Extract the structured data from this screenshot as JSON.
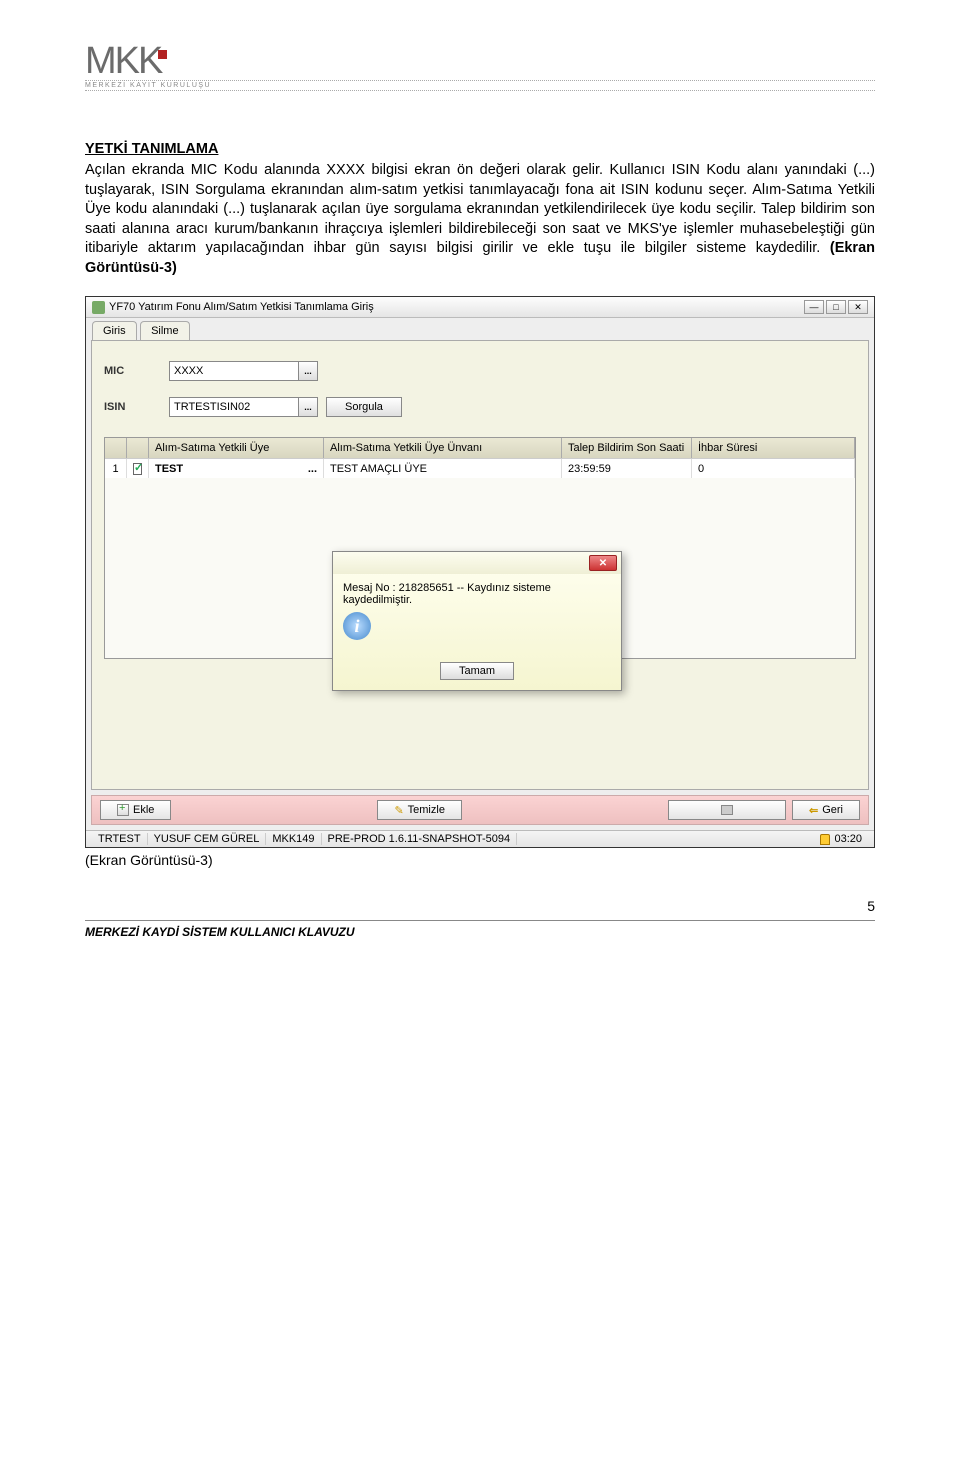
{
  "logo": {
    "text": "MKK",
    "subtitle": "MERKEZİ KAYIT KURULUŞU"
  },
  "section_title": "YETKİ TANIMLAMA",
  "body_text": "Açılan ekranda MIC Kodu alanında XXXX bilgisi ekran ön değeri olarak gelir. Kullanıcı ISIN Kodu alanı yanındaki (...) tuşlayarak, ISIN Sorgulama ekranından alım-satım yetkisi tanımlayacağı fona ait ISIN kodunu seçer. Alım-Satıma Yetkili Üye kodu alanındaki (...) tuşlanarak açılan üye sorgulama ekranından yetkilendirilecek üye kodu seçilir. Talep bildirim son saati alanına aracı kurum/bankanın ihraçcıya işlemleri bildirebileceği son saat ve  MKS'ye işlemler muhasebeleştiği gün itibariyle aktarım yapılacağından ihbar gün sayısı bilgisi girilir ve ekle tuşu ile bilgiler sisteme kaydedilir. ",
  "body_bold_suffix": "(Ekran Görüntüsü-3)",
  "window": {
    "title": "YF70 Yatırım Fonu Alım/Satım Yetkisi Tanımlama Giriş",
    "tabs": [
      "Giris",
      "Silme"
    ],
    "form": {
      "mic_label": "MIC",
      "mic_value": "XXXX",
      "isin_label": "ISIN",
      "isin_value": "TRTESTISIN02",
      "sorgula_label": "Sorgula"
    },
    "grid": {
      "headers": {
        "uye": "Alım-Satıma Yetkili Üye",
        "unvan": "Alım-Satıma Yetkili Üye Ünvanı",
        "talep": "Talep Bildirim Son Saati",
        "ihbar": "İhbar Süresi"
      },
      "row1": {
        "num": "1",
        "uye": "TEST",
        "unvan": "TEST AMAÇLI ÜYE",
        "talep": "23:59:59",
        "ihbar": "0"
      }
    },
    "dialog": {
      "message": "Mesaj No : 218285651 -- Kaydınız sisteme kaydedilmiştir.",
      "ok": "Tamam"
    },
    "actions": {
      "ekle": "Ekle",
      "temizle": "Temizle",
      "geri": "Geri"
    },
    "status": {
      "s1": "TRTEST",
      "s2": "YUSUF CEM GÜREL",
      "s3": "MKK149",
      "s4": "PRE-PROD 1.6.11-SNAPSHOT-5094",
      "time": "03:20"
    }
  },
  "caption": "(Ekran Görüntüsü-3)",
  "page_number": "5",
  "footer": "MERKEZİ KAYDİ SİSTEM KULLANICI KLAVUZU"
}
